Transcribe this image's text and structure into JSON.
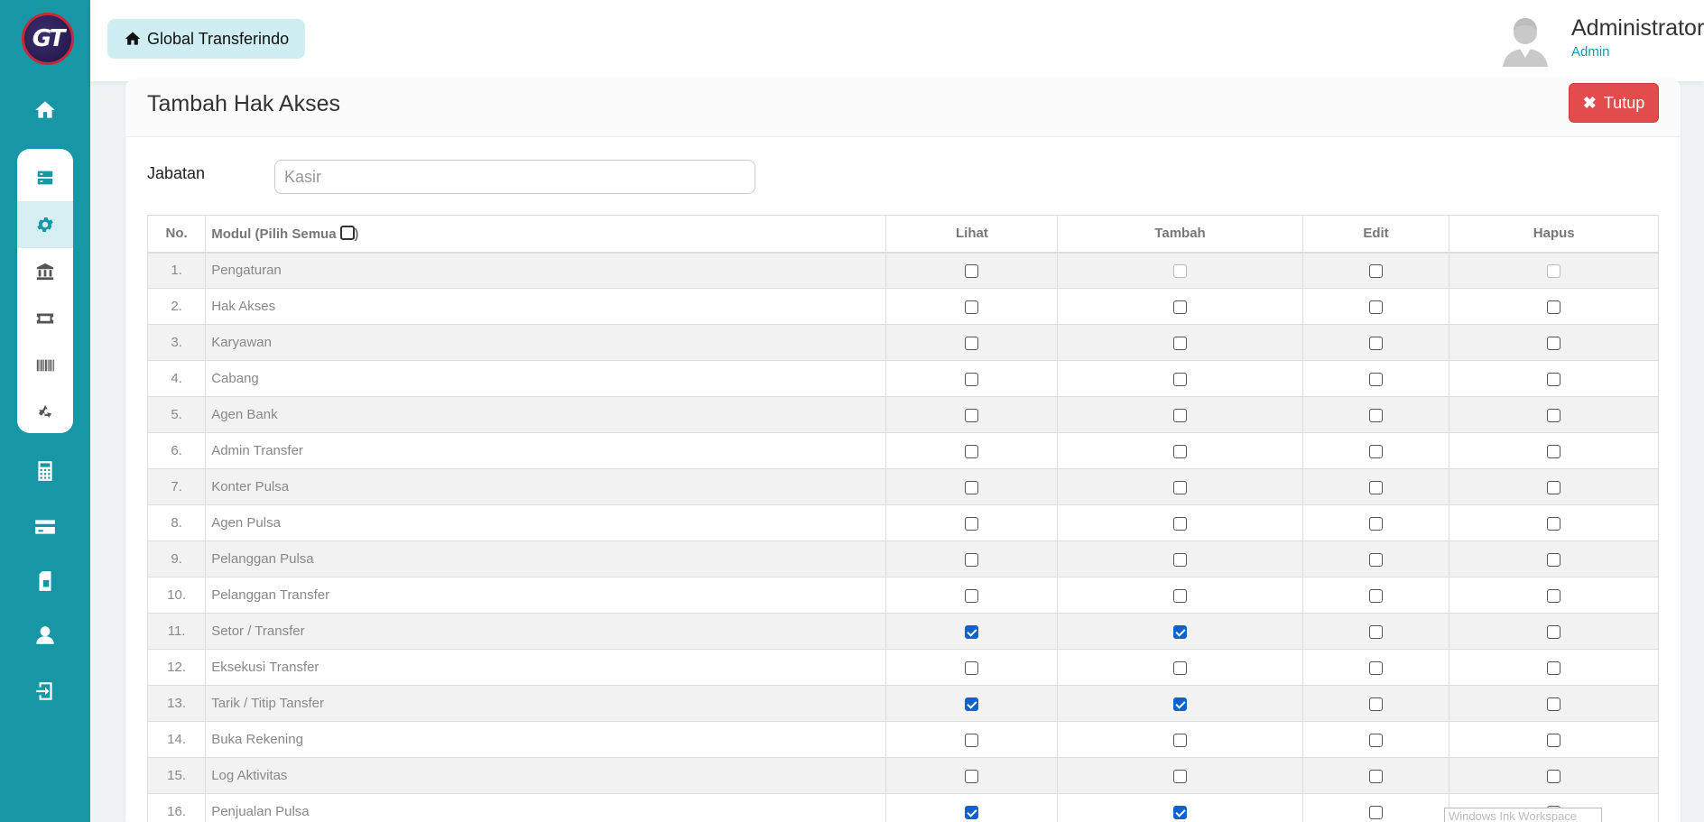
{
  "app": {
    "logo_text": "GT"
  },
  "sidebar": {
    "top_items": [
      "home-icon"
    ],
    "group_items": [
      "server-icon",
      "gear-icon",
      "bank-icon",
      "ticket-icon",
      "barcode-icon",
      "recycle-icon"
    ],
    "bottom_items": [
      "calculator-icon",
      "credit-card-icon",
      "sim-card-icon",
      "user-icon",
      "logout-icon"
    ]
  },
  "header": {
    "brand_label": "Global Transferindo",
    "user_name": "Administrator",
    "user_role": "Admin"
  },
  "card": {
    "title": "Tambah Hak Akses",
    "close_label": "Tutup",
    "jabatan_label": "Jabatan",
    "jabatan_placeholder": "Kasir"
  },
  "table": {
    "headers": {
      "no": "No.",
      "module": "Modul (Pilih Semua",
      "module_suffix": ")",
      "lihat": "Lihat",
      "tambah": "Tambah",
      "edit": "Edit",
      "hapus": "Hapus"
    },
    "rows": [
      {
        "no": "1.",
        "module": "Pengaturan",
        "lihat": false,
        "tambah": "disabled",
        "edit": false,
        "hapus": "disabled"
      },
      {
        "no": "2.",
        "module": "Hak Akses",
        "lihat": false,
        "tambah": false,
        "edit": false,
        "hapus": false
      },
      {
        "no": "3.",
        "module": "Karyawan",
        "lihat": false,
        "tambah": false,
        "edit": false,
        "hapus": false
      },
      {
        "no": "4.",
        "module": "Cabang",
        "lihat": false,
        "tambah": false,
        "edit": false,
        "hapus": false
      },
      {
        "no": "5.",
        "module": "Agen Bank",
        "lihat": false,
        "tambah": false,
        "edit": false,
        "hapus": false
      },
      {
        "no": "6.",
        "module": "Admin Transfer",
        "lihat": false,
        "tambah": false,
        "edit": false,
        "hapus": false
      },
      {
        "no": "7.",
        "module": "Konter Pulsa",
        "lihat": false,
        "tambah": false,
        "edit": false,
        "hapus": false
      },
      {
        "no": "8.",
        "module": "Agen Pulsa",
        "lihat": false,
        "tambah": false,
        "edit": false,
        "hapus": false
      },
      {
        "no": "9.",
        "module": "Pelanggan Pulsa",
        "lihat": false,
        "tambah": false,
        "edit": false,
        "hapus": false
      },
      {
        "no": "10.",
        "module": "Pelanggan Transfer",
        "lihat": false,
        "tambah": false,
        "edit": false,
        "hapus": false
      },
      {
        "no": "11.",
        "module": "Setor / Transfer",
        "lihat": true,
        "tambah": true,
        "edit": false,
        "hapus": false
      },
      {
        "no": "12.",
        "module": "Eksekusi Transfer",
        "lihat": false,
        "tambah": false,
        "edit": false,
        "hapus": false
      },
      {
        "no": "13.",
        "module": "Tarik / Titip Tansfer",
        "lihat": true,
        "tambah": true,
        "edit": false,
        "hapus": false
      },
      {
        "no": "14.",
        "module": "Buka Rekening",
        "lihat": false,
        "tambah": false,
        "edit": false,
        "hapus": false
      },
      {
        "no": "15.",
        "module": "Log Aktivitas",
        "lihat": false,
        "tambah": false,
        "edit": false,
        "hapus": false
      },
      {
        "no": "16.",
        "module": "Penjualan Pulsa",
        "lihat": true,
        "tambah": true,
        "edit": false,
        "hapus": false
      }
    ]
  },
  "overlay": {
    "ink_workspace": "Windows Ink Workspace"
  },
  "colors": {
    "sidebar": "#1797a6",
    "close_button": "#e34c4c",
    "brand_button": "#cfeef2",
    "checkbox_checked": "#0b63ce"
  }
}
